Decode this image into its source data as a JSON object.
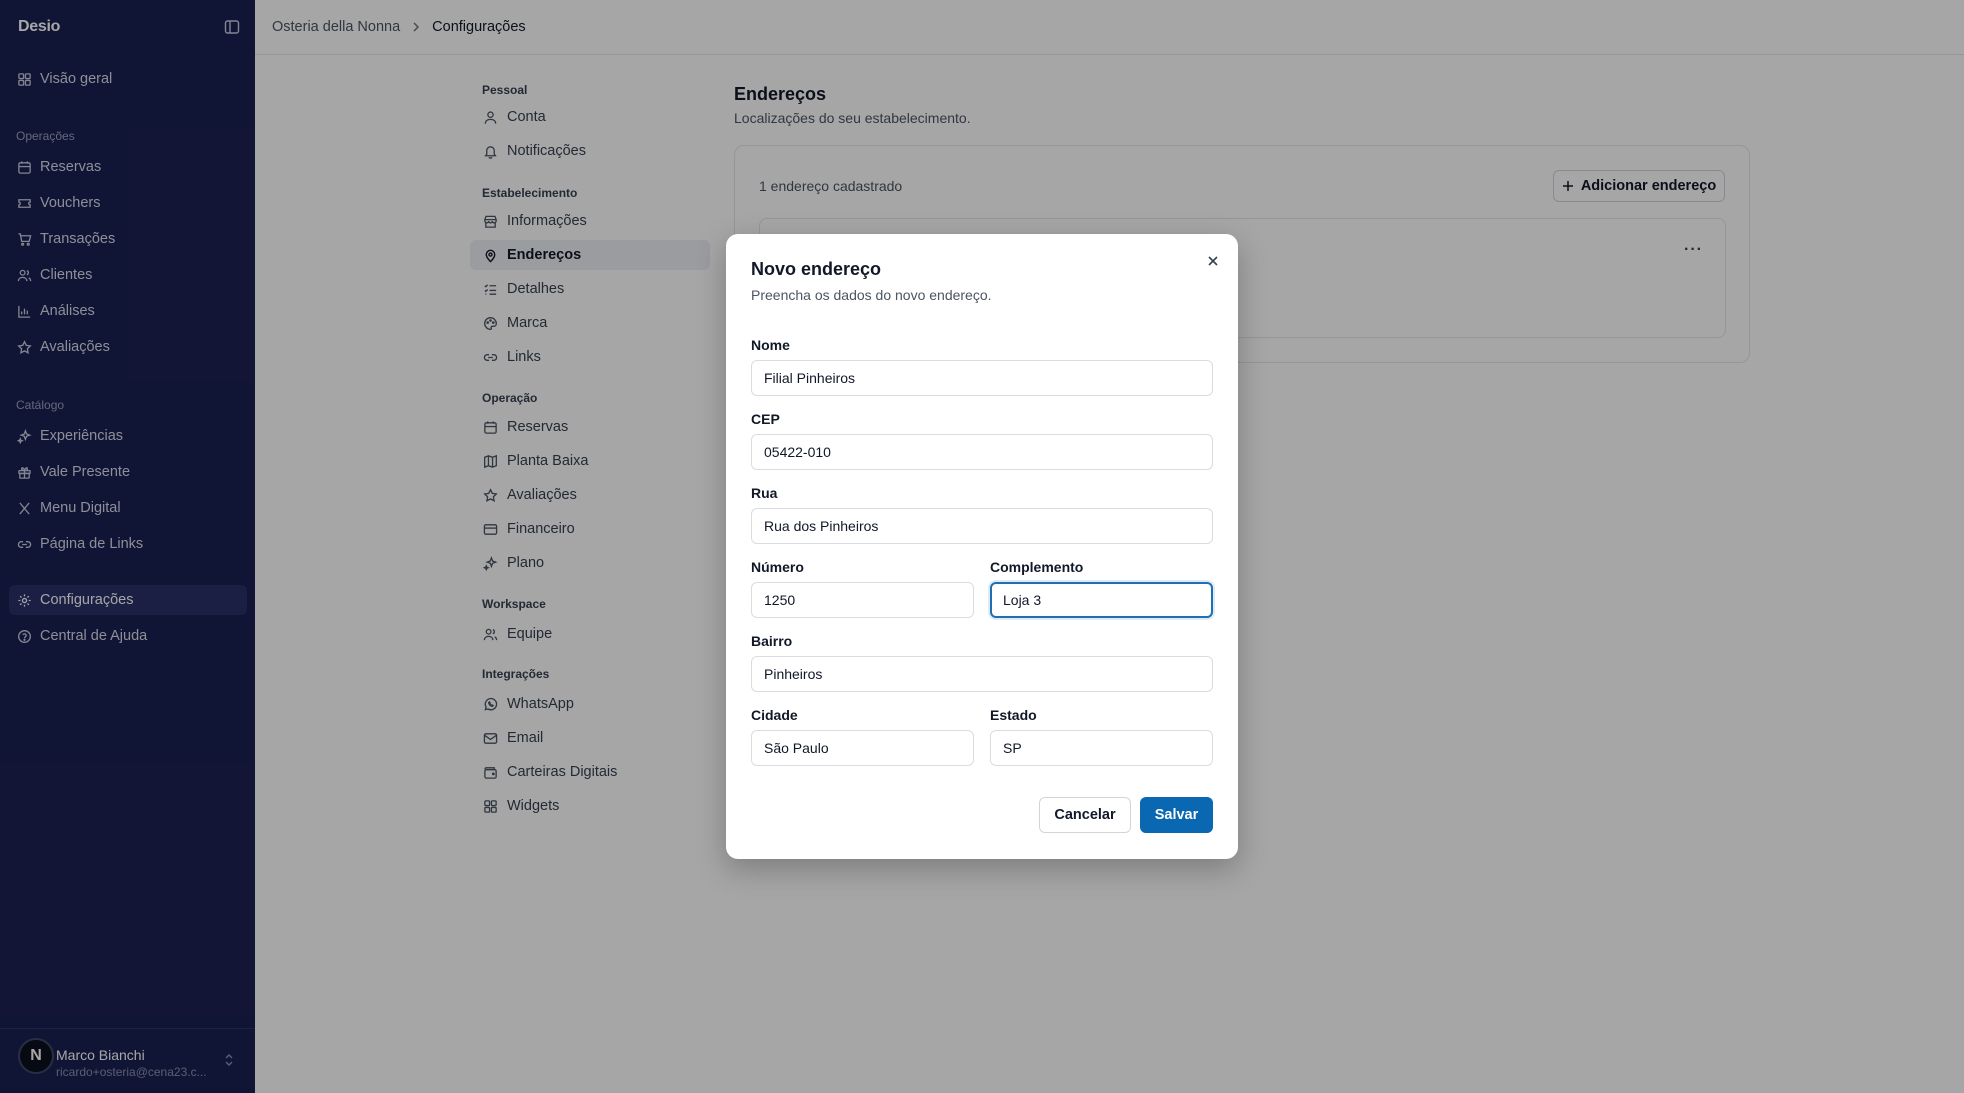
{
  "app": {
    "brand": "Desio"
  },
  "sidebar": {
    "top_item": {
      "label": "Visão geral",
      "icon": "grid-icon"
    },
    "groups": [
      {
        "title": "Operações",
        "items": [
          {
            "label": "Reservas",
            "icon": "calendar-icon"
          },
          {
            "label": "Vouchers",
            "icon": "ticket-icon"
          },
          {
            "label": "Transações",
            "icon": "cart-icon"
          },
          {
            "label": "Clientes",
            "icon": "users-icon"
          },
          {
            "label": "Análises",
            "icon": "bar-chart-icon"
          },
          {
            "label": "Avaliações",
            "icon": "star-icon"
          }
        ]
      },
      {
        "title": "Catálogo",
        "items": [
          {
            "label": "Experiências",
            "icon": "sparkle-icon"
          },
          {
            "label": "Vale Presente",
            "icon": "gift-icon"
          },
          {
            "label": "Menu Digital",
            "icon": "utensils-icon"
          },
          {
            "label": "Página de Links",
            "icon": "link-icon"
          }
        ]
      }
    ],
    "bottom_items": [
      {
        "label": "Configurações",
        "icon": "gear-icon",
        "active": true
      },
      {
        "label": "Central de Ajuda",
        "icon": "help-icon"
      }
    ],
    "user": {
      "initial": "N",
      "name": "Marco Bianchi",
      "email": "ricardo+osteria@cena23.c..."
    }
  },
  "breadcrumb": {
    "root": "Osteria della Nonna",
    "current": "Configurações"
  },
  "settings_nav": {
    "groups": [
      {
        "title": "Pessoal",
        "items": [
          {
            "label": "Conta",
            "icon": "user-icon"
          },
          {
            "label": "Notificações",
            "icon": "bell-icon"
          }
        ]
      },
      {
        "title": "Estabelecimento",
        "items": [
          {
            "label": "Informações",
            "icon": "store-icon"
          },
          {
            "label": "Endereços",
            "icon": "map-pin-icon",
            "active": true
          },
          {
            "label": "Detalhes",
            "icon": "list-icon"
          },
          {
            "label": "Marca",
            "icon": "palette-icon"
          },
          {
            "label": "Links",
            "icon": "link-icon"
          }
        ]
      },
      {
        "title": "Operação",
        "items": [
          {
            "label": "Reservas",
            "icon": "calendar-icon"
          },
          {
            "label": "Planta Baixa",
            "icon": "map-icon"
          },
          {
            "label": "Avaliações",
            "icon": "star-icon"
          },
          {
            "label": "Financeiro",
            "icon": "credit-card-icon"
          },
          {
            "label": "Plano",
            "icon": "sparkle-icon"
          }
        ]
      },
      {
        "title": "Workspace",
        "items": [
          {
            "label": "Equipe",
            "icon": "users-icon"
          }
        ]
      },
      {
        "title": "Integrações",
        "items": [
          {
            "label": "WhatsApp",
            "icon": "whatsapp-icon"
          },
          {
            "label": "Email",
            "icon": "mail-icon"
          },
          {
            "label": "Carteiras Digitais",
            "icon": "wallet-icon"
          },
          {
            "label": "Widgets",
            "icon": "widgets-icon"
          }
        ]
      }
    ]
  },
  "content": {
    "title": "Endereços",
    "subtitle": "Localizações do seu estabelecimento.",
    "count_text": "1 endereço cadastrado",
    "add_button": "Adicionar endereço",
    "more_label": "···"
  },
  "modal": {
    "title": "Novo endereço",
    "description": "Preencha os dados do novo endereço.",
    "fields": {
      "nome": {
        "label": "Nome",
        "value": "Filial Pinheiros"
      },
      "cep": {
        "label": "CEP",
        "value": "05422-010"
      },
      "rua": {
        "label": "Rua",
        "value": "Rua dos Pinheiros"
      },
      "numero": {
        "label": "Número",
        "value": "1250"
      },
      "complemento": {
        "label": "Complemento",
        "value": "Loja 3"
      },
      "bairro": {
        "label": "Bairro",
        "value": "Pinheiros"
      },
      "cidade": {
        "label": "Cidade",
        "value": "São Paulo"
      },
      "estado": {
        "label": "Estado",
        "value": "SP"
      }
    },
    "cancel_label": "Cancelar",
    "save_label": "Salvar"
  },
  "colors": {
    "sidebar_bg": "#1b2152",
    "primary": "#0a67b1",
    "focus": "#1f6fb3"
  }
}
